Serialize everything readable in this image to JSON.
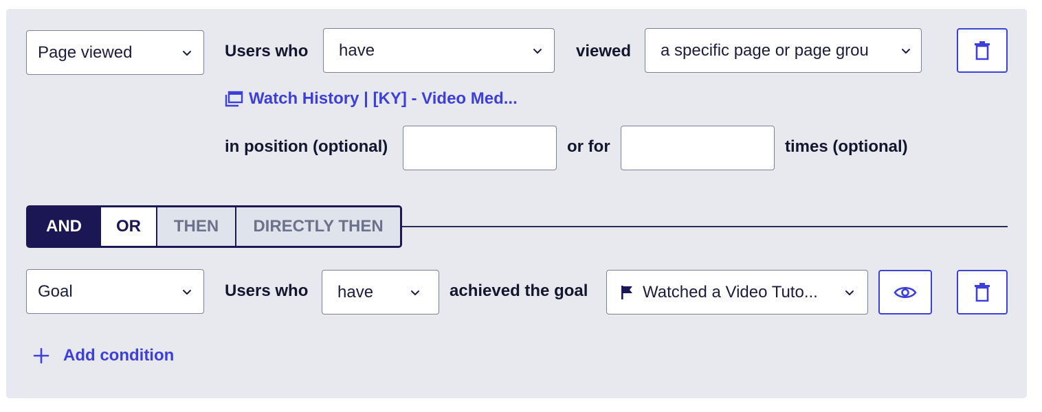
{
  "condition1": {
    "type_select": "Page viewed",
    "users_who_label": "Users who",
    "have_select": "have",
    "viewed_label": "viewed",
    "target_select": "a specific page or page grou",
    "page_link": "Watch History | [KY] - Video Med...",
    "position_label": "in position (optional)",
    "position_value": "",
    "or_for_label": "or for",
    "times_value": "",
    "times_label": "times (optional)"
  },
  "connector": {
    "options": [
      "AND",
      "OR",
      "THEN",
      "DIRECTLY THEN"
    ],
    "selected": "AND"
  },
  "condition2": {
    "type_select": "Goal",
    "users_who_label": "Users who",
    "have_select": "have",
    "achieved_label": "achieved the goal",
    "goal_select": "Watched a Video Tuto..."
  },
  "add_condition_label": "Add condition",
  "icons": {
    "delete": "trash-icon",
    "preview": "eye-icon",
    "page_group": "pages-icon",
    "goal": "flag-icon",
    "add": "plus-icon",
    "dropdown": "chevron-down-icon"
  },
  "colors": {
    "accent": "#3c3fd8",
    "dark": "#1b1755",
    "panel_bg": "#e7e9ef"
  }
}
